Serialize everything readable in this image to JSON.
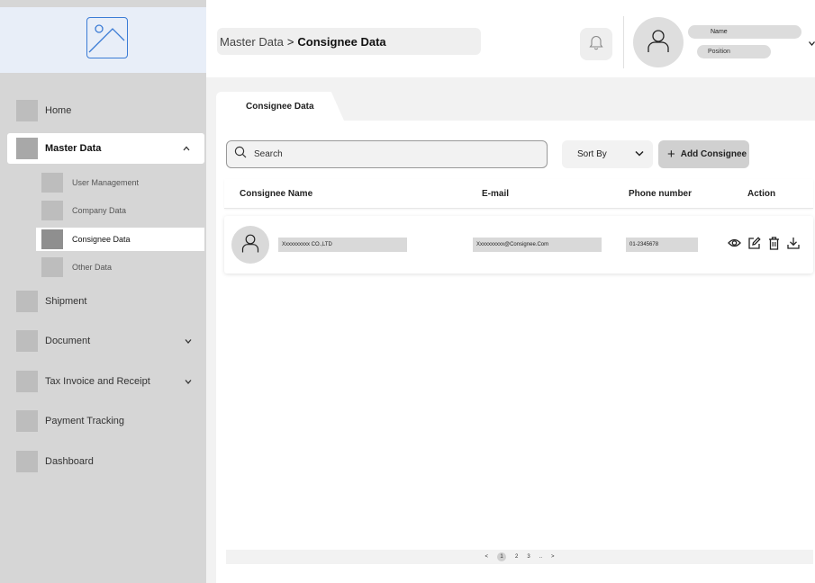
{
  "header": {
    "breadcrumb": {
      "parent": "Master Data",
      "separator": ">",
      "current": "Consignee Data"
    },
    "profile": {
      "name": "Name",
      "position": "Position"
    }
  },
  "sidebar": {
    "items": [
      {
        "label": "Home"
      },
      {
        "label": "Master Data",
        "chevron": "^"
      },
      {
        "label": "Shipment"
      },
      {
        "label": "Document",
        "chevron": "v"
      },
      {
        "label": "Tax Invoice and Receipt",
        "chevron": "v"
      },
      {
        "label": "Payment Tracking"
      },
      {
        "label": "Dashboard"
      }
    ],
    "master_sub_items": [
      {
        "label": "User Management"
      },
      {
        "label": "Company Data"
      },
      {
        "label": "Consignee Data"
      },
      {
        "label": "Other Data"
      }
    ]
  },
  "main": {
    "tab_label": "Consignee Data",
    "search": {
      "placeholder": "Search"
    },
    "sort_label": "Sort By",
    "add_button_label": "Add Consignee",
    "table": {
      "columns": [
        "Consignee Name",
        "E-mail",
        "Phone number",
        "Action"
      ],
      "rows": [
        {
          "name": "Xxxxxxxxxx CO.,LTD",
          "email": "Xxxxxxxxxx@Consignee.Com",
          "phone": "01-2345678"
        }
      ]
    },
    "pagination": {
      "prev": "<",
      "pages": [
        "1",
        "2",
        "3",
        ".."
      ],
      "current": "1",
      "next": ">"
    }
  },
  "colors": {
    "sidebar_bg": "#d6d6d6",
    "logo_bg": "#e8eef8",
    "logo_icon": "#3a7bd5",
    "main_bg": "#f2f2f2"
  },
  "icons": [
    "image-placeholder-icon",
    "bell-icon",
    "user-icon",
    "search-icon",
    "chevron-down-icon",
    "plus-icon",
    "eye-icon",
    "edit-icon",
    "trash-icon",
    "download-icon"
  ]
}
